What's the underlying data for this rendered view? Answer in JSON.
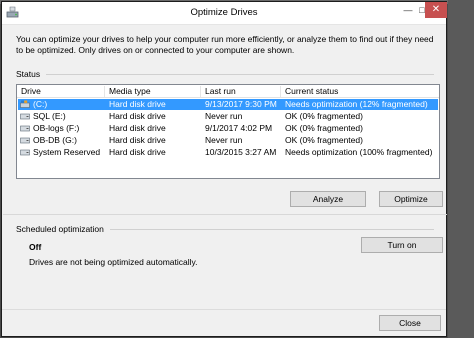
{
  "window": {
    "title": "Optimize Drives"
  },
  "description": "You can optimize your drives to help your computer run more efficiently, or analyze them to find out if they need to be optimized. Only drives on or connected to your computer are shown.",
  "status": {
    "label": "Status",
    "columns": [
      "Drive",
      "Media type",
      "Last run",
      "Current status"
    ],
    "rows": [
      {
        "drive": "(C:)",
        "media": "Hard disk drive",
        "last_run": "9/13/2017 9:30 PM",
        "status": "Needs optimization (12% fragmented)",
        "icon": "system-drive-icon",
        "selected": true
      },
      {
        "drive": "SQL (E:)",
        "media": "Hard disk drive",
        "last_run": "Never run",
        "status": "OK (0% fragmented)",
        "icon": "drive-icon",
        "selected": false
      },
      {
        "drive": "OB-logs (F:)",
        "media": "Hard disk drive",
        "last_run": "9/1/2017 4:02 PM",
        "status": "OK (0% fragmented)",
        "icon": "drive-icon",
        "selected": false
      },
      {
        "drive": "OB-DB (G:)",
        "media": "Hard disk drive",
        "last_run": "Never run",
        "status": "OK (0% fragmented)",
        "icon": "drive-icon",
        "selected": false
      },
      {
        "drive": "System Reserved",
        "media": "Hard disk drive",
        "last_run": "10/3/2015 3:27 AM",
        "status": "Needs optimization (100% fragmented)",
        "icon": "drive-icon",
        "selected": false
      }
    ]
  },
  "buttons": {
    "analyze": "Analyze",
    "optimize": "Optimize",
    "turn_on": "Turn on",
    "close": "Close"
  },
  "scheduled": {
    "label": "Scheduled optimization",
    "state": "Off",
    "message": "Drives are not being optimized automatically."
  },
  "colors": {
    "selection": "#3399ff",
    "close_button": "#c75050"
  }
}
